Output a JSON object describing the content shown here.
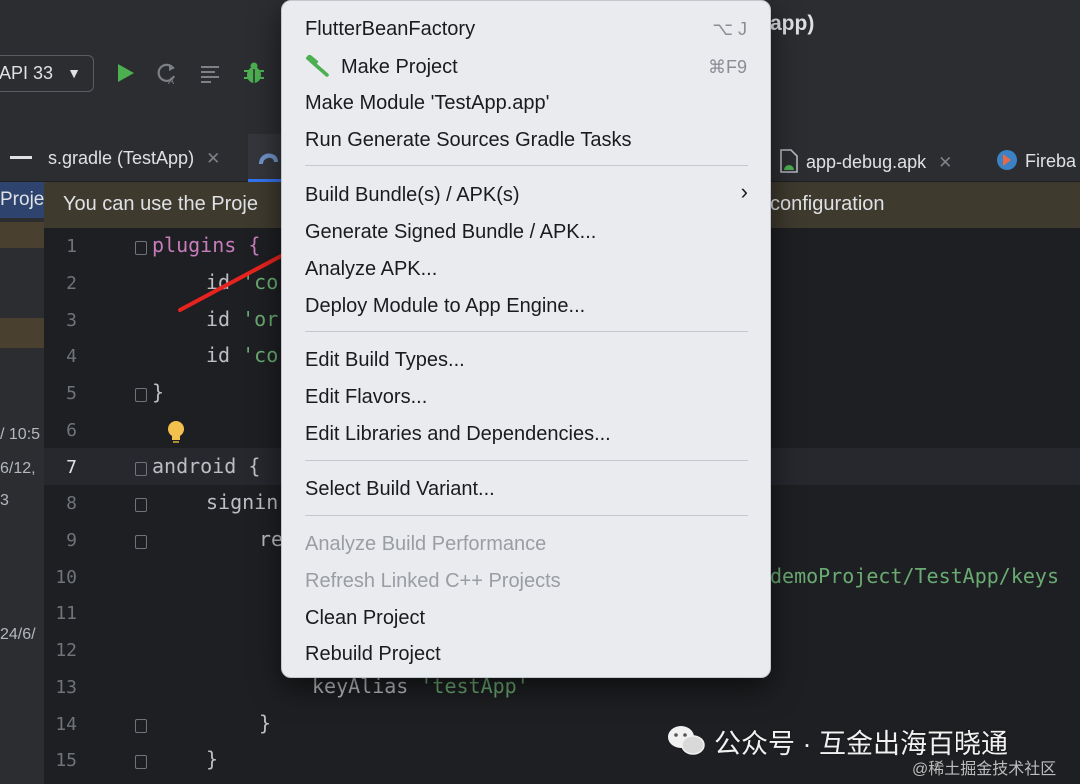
{
  "window": {
    "title": "app)"
  },
  "toolbar": {
    "config": "API 33"
  },
  "tabs": [
    {
      "label": "s.gradle (TestApp)"
    },
    {
      "label": "app-debug.apk"
    },
    {
      "label": "Fireba"
    }
  ],
  "left_panel": {
    "project_label": "Proje",
    "timestamps": [
      "/ 10:5",
      "6/12,",
      "3",
      "24/6/"
    ]
  },
  "banner": {
    "left_text": "You can use the Proje",
    "right_text": "configuration"
  },
  "editor": {
    "line_numbers": [
      "1",
      "2",
      "3",
      "4",
      "5",
      "6",
      "7",
      "8",
      "9",
      "10",
      "11",
      "12",
      "13",
      "14",
      "15"
    ],
    "lines": {
      "l1": "plugins {",
      "l2_id": "id",
      "l2_str": "'co",
      "l3_id": "id",
      "l3_str": "'or",
      "l4_id": "id",
      "l4_str": "'co",
      "l5": "}",
      "l7": "android {",
      "l8": "signin",
      "l9": "re",
      "l10_str": "demoProject/TestApp/keys",
      "l13_kw": "keyAlias",
      "l13_str": "'testApp'",
      "l14": "}",
      "l15": "}"
    }
  },
  "menu": {
    "items": [
      {
        "label": "FlutterBeanFactory",
        "shortcut": "⌥ J"
      },
      {
        "label": "Make Project",
        "shortcut": "⌘F9"
      },
      {
        "label": "Make Module 'TestApp.app'"
      },
      {
        "label": "Run Generate Sources Gradle Tasks"
      },
      {
        "label": "Build Bundle(s) / APK(s)"
      },
      {
        "label": "Generate Signed Bundle / APK..."
      },
      {
        "label": "Analyze APK..."
      },
      {
        "label": "Deploy Module to App Engine..."
      },
      {
        "label": "Edit Build Types..."
      },
      {
        "label": "Edit Flavors..."
      },
      {
        "label": "Edit Libraries and Dependencies..."
      },
      {
        "label": "Select Build Variant..."
      },
      {
        "label": "Analyze Build Performance"
      },
      {
        "label": "Refresh Linked C++ Projects"
      },
      {
        "label": "Clean Project"
      },
      {
        "label": "Rebuild Project"
      }
    ]
  },
  "watermark": {
    "main": "公众号 · 互金出海百晓通",
    "sub": "@稀土掘金技术社区"
  },
  "colors": {
    "menu_bg": "#e9ebef",
    "editor_bg": "#1e1f22",
    "keyword": "#c77dbb",
    "string": "#6aab73",
    "arrow": "#e8231f",
    "run_green": "#4caf50"
  }
}
